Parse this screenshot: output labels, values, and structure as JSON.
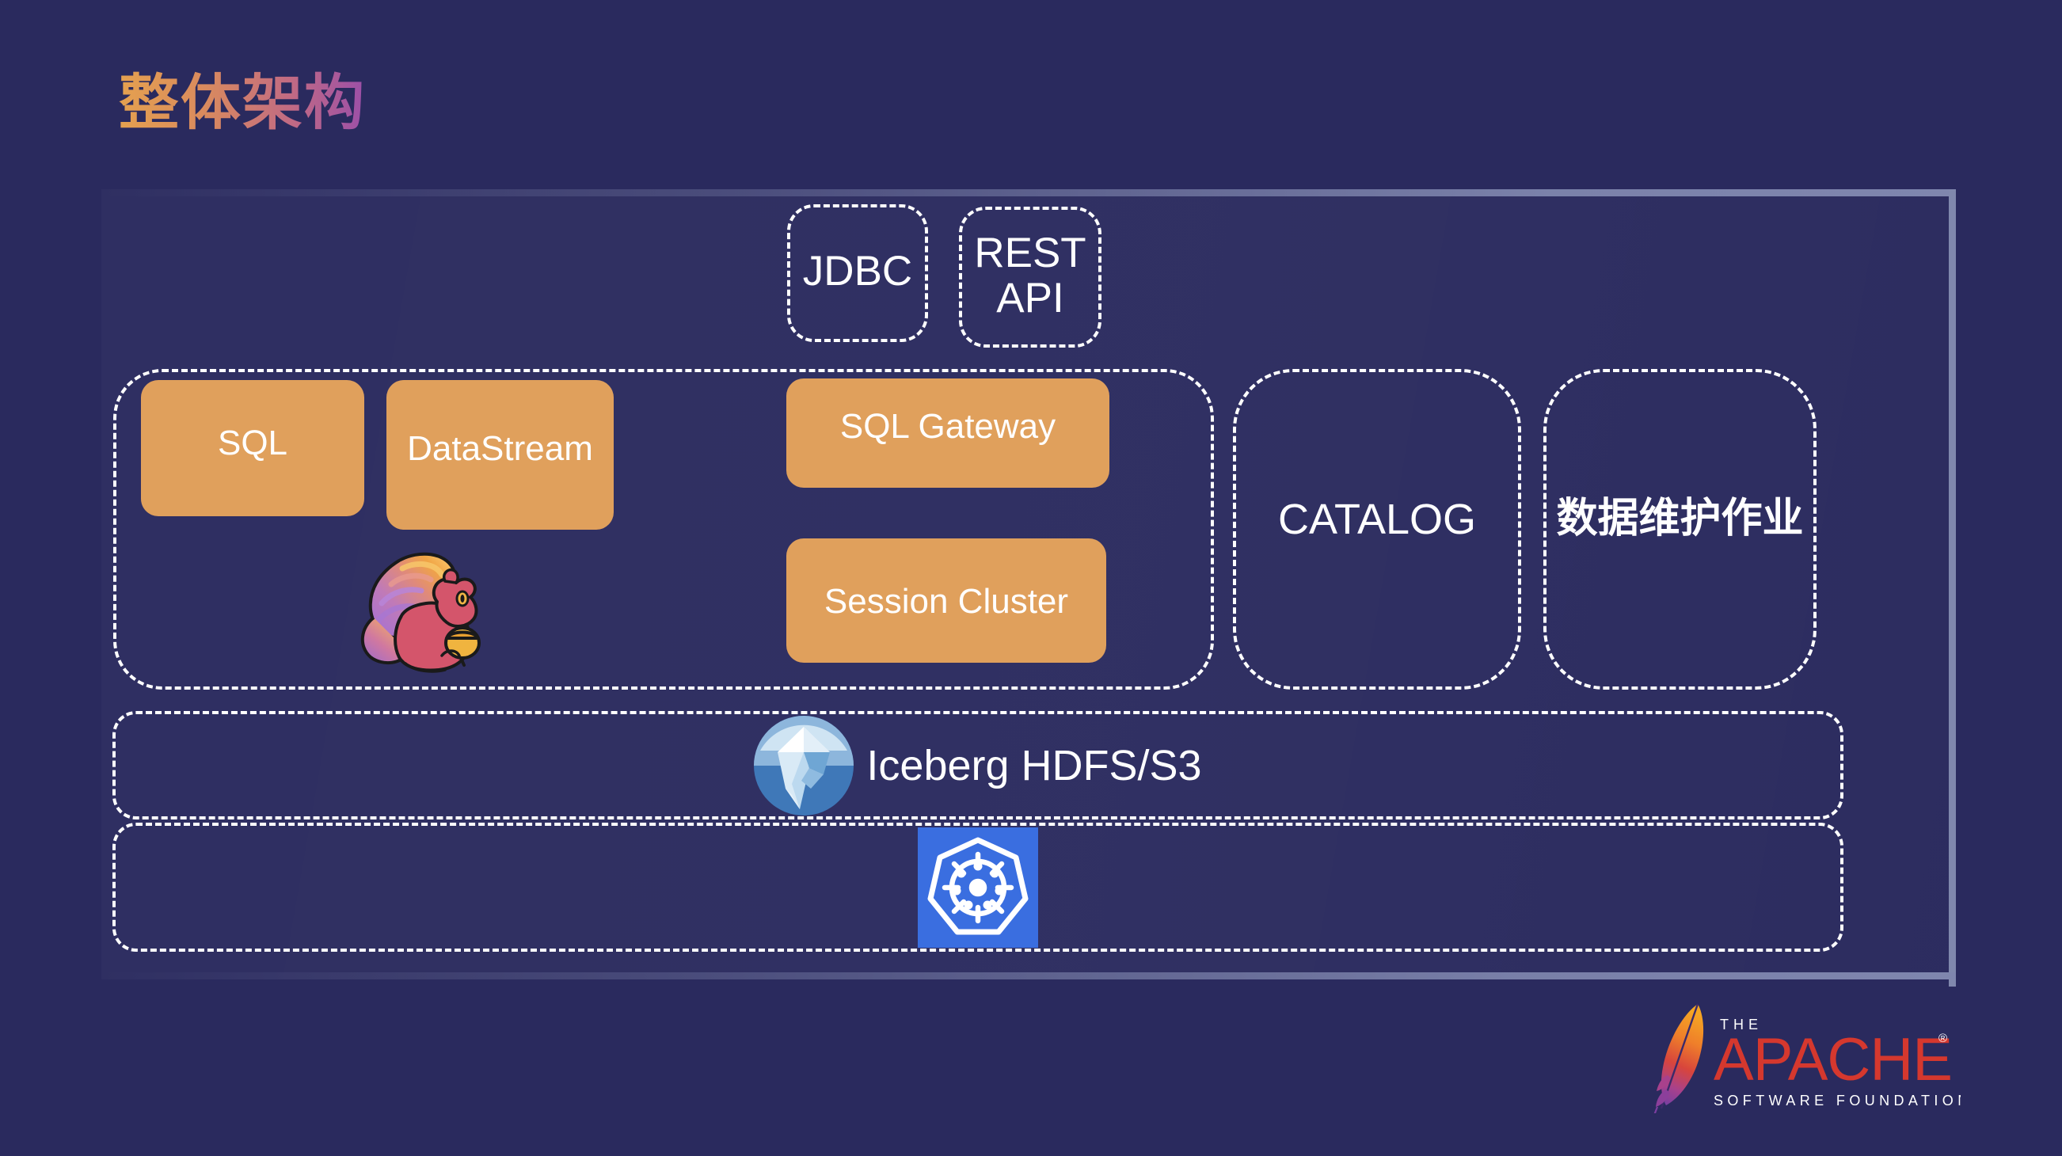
{
  "slide": {
    "title": "整体架构",
    "background_color": "#2a2a5e",
    "accent_orange": "#e0a05c",
    "frame_border_color": "#8088ad",
    "dashed_border_color": "#ffffff"
  },
  "api_boxes": [
    {
      "id": "jdbc",
      "label": "JDBC"
    },
    {
      "id": "rest-api",
      "label": "REST\nAPI",
      "line1": "REST",
      "line2": "API"
    }
  ],
  "flink_group": {
    "name": "flink-container",
    "logo": "flink-squirrel-icon",
    "items": [
      {
        "id": "sql",
        "label": "SQL"
      },
      {
        "id": "datastream",
        "label": "DataStream"
      },
      {
        "id": "sql-gateway",
        "label": "SQL Gateway"
      },
      {
        "id": "session-cluster",
        "label": "Session Cluster"
      }
    ]
  },
  "side_boxes": [
    {
      "id": "catalog",
      "label": "CATALOG"
    },
    {
      "id": "maintenance-jobs",
      "label": "数据维护作业"
    }
  ],
  "storage_row": {
    "label": "Iceberg HDFS/S3",
    "logo": "iceberg-icon"
  },
  "platform_row": {
    "logo": "kubernetes-icon"
  },
  "footer": {
    "logo": "apache-software-foundation-logo",
    "the": "THE",
    "apache": "APACHE",
    "registered": "®",
    "foundation": "SOFTWARE FOUNDATION"
  }
}
